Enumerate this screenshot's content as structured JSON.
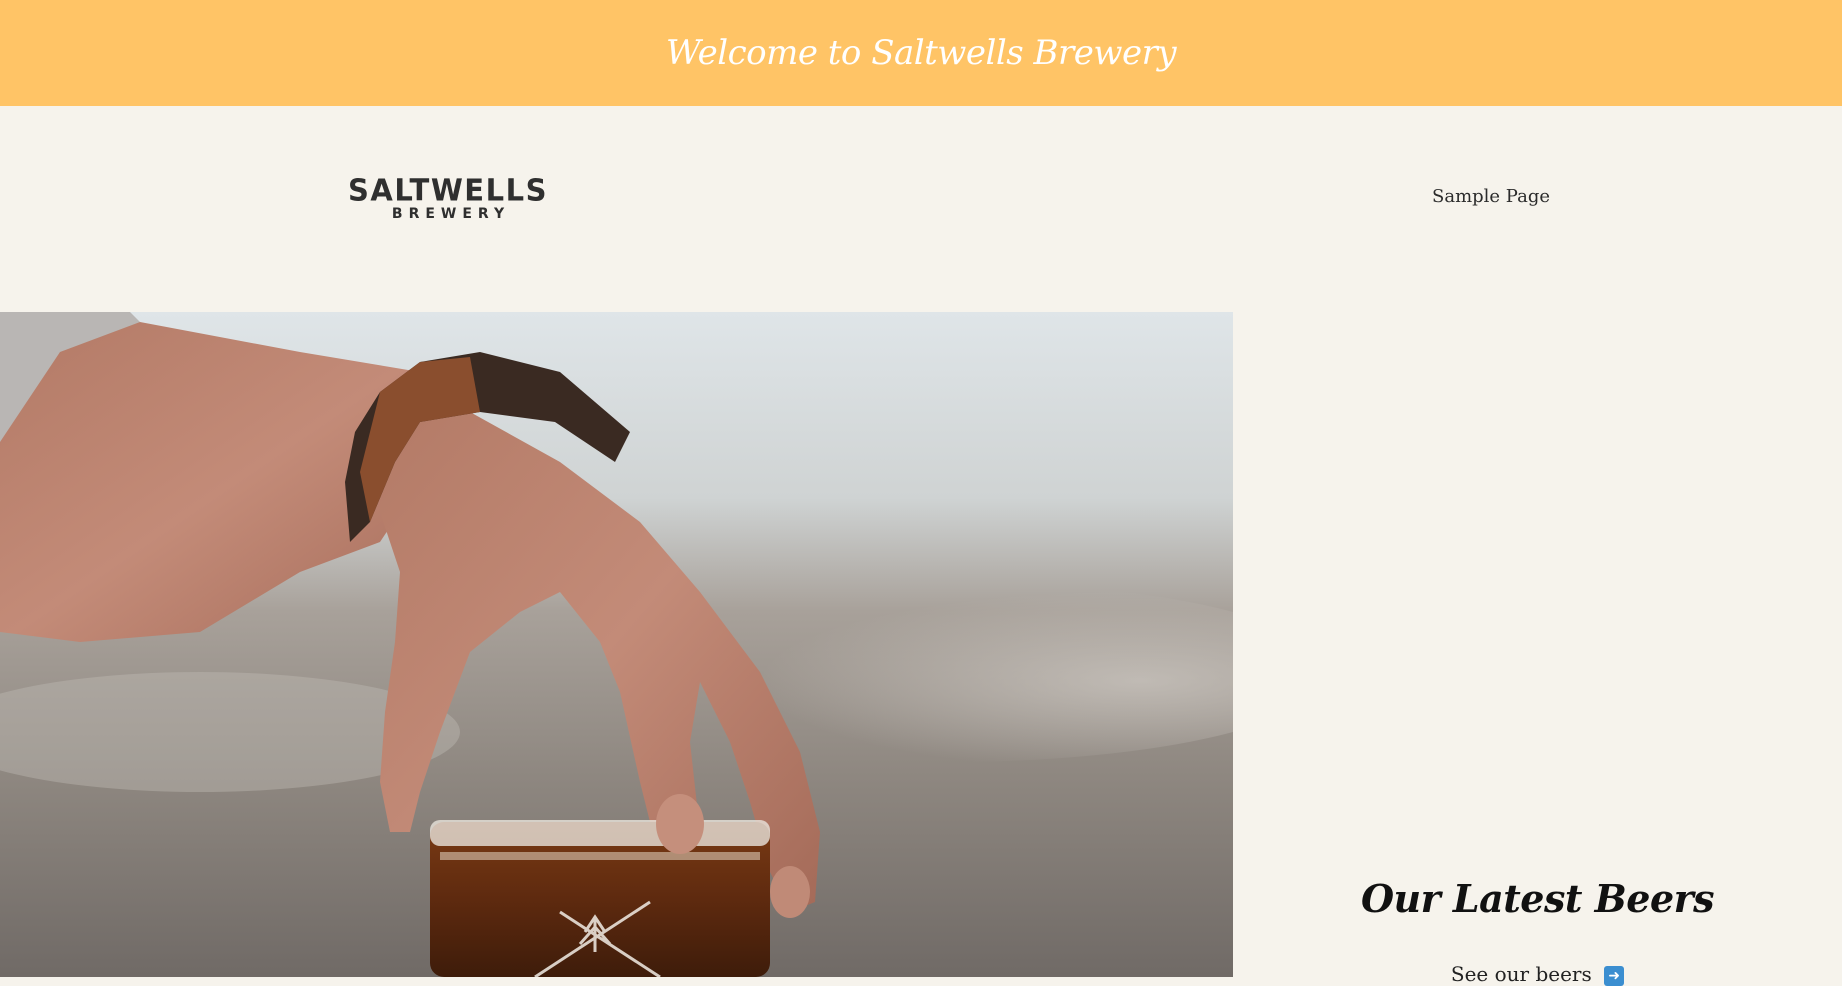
{
  "announcement": {
    "text": "Welcome to Saltwells Brewery",
    "background": "#ffc466"
  },
  "header": {
    "logo": {
      "main": "SALTWELLS",
      "sub": "BREWERY"
    },
    "nav": {
      "items": [
        {
          "label": "Sample Page"
        }
      ]
    }
  },
  "hero": {
    "image": "hand-holding-beer-glass-photo"
  },
  "sidebar": {
    "title": "Our Latest Beers",
    "link_label": "See our beers",
    "link_icon": "arrow-right-icon"
  },
  "colors": {
    "page_background": "#f6f3ec",
    "accent": "#ffc466",
    "text": "#2b2b2b"
  }
}
